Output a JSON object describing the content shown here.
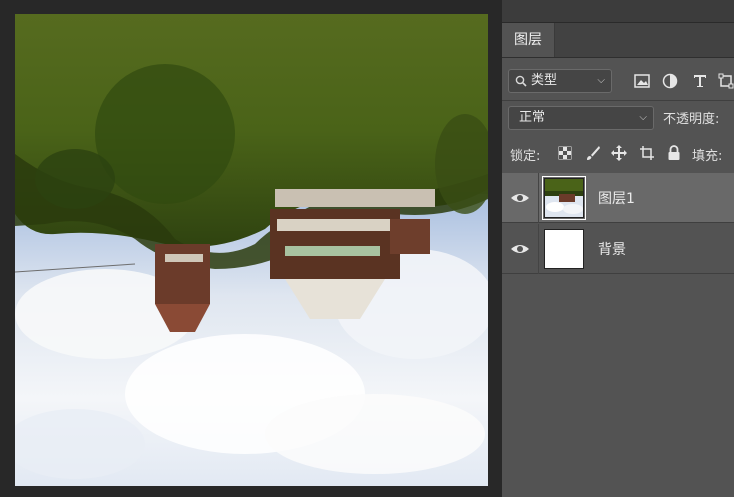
{
  "layers_panel": {
    "tab_label": "图层",
    "filter": {
      "selected": "类型",
      "icons": [
        "image-filter-icon",
        "adjustment-filter-icon",
        "type-filter-icon",
        "shape-filter-icon"
      ]
    },
    "blend_mode": {
      "selected": "正常"
    },
    "opacity_label": "不透明度:",
    "lock_label": "锁定:",
    "lock_icons": [
      "lock-transparent-icon",
      "lock-paint-icon",
      "lock-move-icon",
      "lock-artboard-icon",
      "lock-all-icon"
    ],
    "fill_label": "填充:",
    "layers": [
      {
        "name": "图层1",
        "visible": true,
        "selected": true
      },
      {
        "name": "背景",
        "visible": true,
        "selected": false
      }
    ]
  },
  "colors": {
    "panel_bg": "#535353",
    "selected_row": "#696969",
    "canvas_bg": "#282828"
  }
}
